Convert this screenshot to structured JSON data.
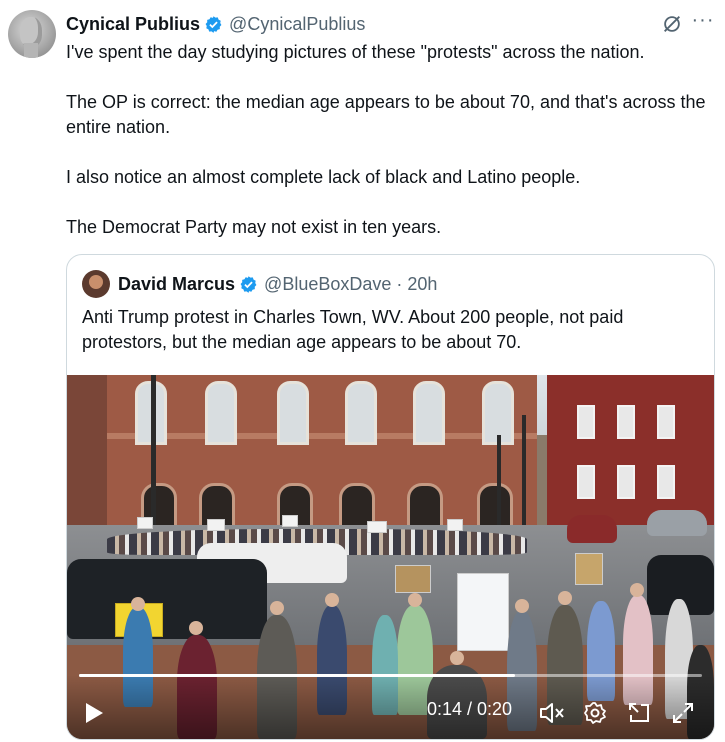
{
  "tweet": {
    "author_name": "Cynical Publius",
    "author_handle": "@CynicalPublius",
    "paragraphs": [
      "I've spent the day studying pictures of these \"protests\" across the nation.",
      "The OP is correct: the median age appears to be about 70, and that's across the entire nation.",
      "I also notice an almost complete lack of black and Latino people.",
      "The Democrat Party may not exist in ten years."
    ],
    "more_label": "···"
  },
  "quote": {
    "author_name": "David Marcus",
    "author_handle": "@BlueBoxDave",
    "separator": "·",
    "time": "20h",
    "text": "Anti Trump protest in Charles Town, WV. About 200 people, not paid protestors, but the median age appears to be about 70."
  },
  "video": {
    "time_display": "0:14 / 0:20",
    "progress": 0.7
  },
  "colors": {
    "verified_blue": "#1d9bf0",
    "secondary_text": "#536471",
    "border": "#cfd9de"
  },
  "icons": [
    "verified-badge-icon",
    "grok-icon",
    "more-icon",
    "play-icon",
    "mute-icon",
    "settings-icon",
    "pip-icon",
    "fullscreen-icon"
  ]
}
